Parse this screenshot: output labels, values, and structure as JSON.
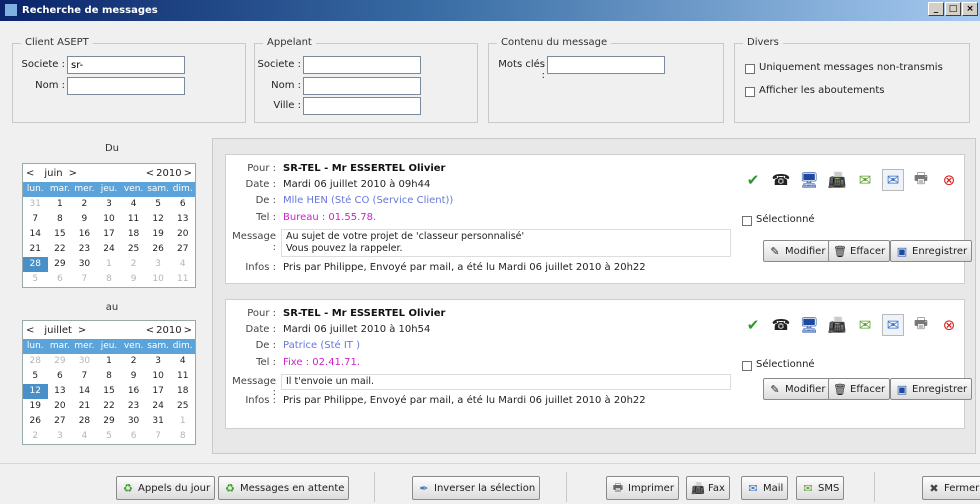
{
  "window": {
    "title": "Recherche de messages",
    "btn_min": "_",
    "btn_max": "□",
    "btn_close": "×"
  },
  "client": {
    "legend": "Client ASEPT",
    "societe_label": "Societe :",
    "societe_value": "sr-",
    "nom_label": "Nom :",
    "nom_value": ""
  },
  "appelant": {
    "legend": "Appelant",
    "societe_label": "Societe :",
    "nom_label": "Nom :",
    "ville_label": "Ville :"
  },
  "contenu": {
    "legend": "Contenu du message",
    "mots_label": "Mots clés :"
  },
  "divers": {
    "legend": "Divers",
    "opt1": "Uniquement messages non-transmis",
    "opt2": "Afficher les aboutements"
  },
  "cal_du": {
    "title": "Du",
    "prev": "<",
    "month": "juin",
    "next": ">",
    "yprev": "<",
    "year": "2010",
    "ynext": ">",
    "dow": [
      "lun.",
      "mar.",
      "mer.",
      "jeu.",
      "ven.",
      "sam.",
      "dim."
    ],
    "days": [
      [
        "31",
        "o"
      ],
      [
        "1",
        ""
      ],
      [
        "2",
        ""
      ],
      [
        "3",
        ""
      ],
      [
        "4",
        ""
      ],
      [
        "5",
        ""
      ],
      [
        "6",
        ""
      ],
      [
        "7",
        ""
      ],
      [
        "8",
        ""
      ],
      [
        "9",
        ""
      ],
      [
        "10",
        ""
      ],
      [
        "11",
        ""
      ],
      [
        "12",
        ""
      ],
      [
        "13",
        ""
      ],
      [
        "14",
        ""
      ],
      [
        "15",
        ""
      ],
      [
        "16",
        ""
      ],
      [
        "17",
        ""
      ],
      [
        "18",
        ""
      ],
      [
        "19",
        ""
      ],
      [
        "20",
        ""
      ],
      [
        "21",
        ""
      ],
      [
        "22",
        ""
      ],
      [
        "23",
        ""
      ],
      [
        "24",
        ""
      ],
      [
        "25",
        ""
      ],
      [
        "26",
        ""
      ],
      [
        "27",
        ""
      ],
      [
        "28",
        "s"
      ],
      [
        "29",
        ""
      ],
      [
        "30",
        ""
      ],
      [
        "1",
        "o"
      ],
      [
        "2",
        "o"
      ],
      [
        "3",
        "o"
      ],
      [
        "4",
        "o"
      ],
      [
        "5",
        "o"
      ],
      [
        "6",
        "o"
      ],
      [
        "7",
        "o"
      ],
      [
        "8",
        "o"
      ],
      [
        "9",
        "o"
      ],
      [
        "10",
        "o"
      ],
      [
        "11",
        "o"
      ]
    ]
  },
  "cal_au": {
    "title": "au",
    "prev": "<",
    "month": "juillet",
    "next": ">",
    "yprev": "<",
    "year": "2010",
    "ynext": ">",
    "dow": [
      "lun.",
      "mar.",
      "mer.",
      "jeu.",
      "ven.",
      "sam.",
      "dim."
    ],
    "days": [
      [
        "28",
        "o"
      ],
      [
        "29",
        "o"
      ],
      [
        "30",
        "o"
      ],
      [
        "1",
        ""
      ],
      [
        "2",
        ""
      ],
      [
        "3",
        ""
      ],
      [
        "4",
        ""
      ],
      [
        "5",
        ""
      ],
      [
        "6",
        ""
      ],
      [
        "7",
        ""
      ],
      [
        "8",
        ""
      ],
      [
        "9",
        ""
      ],
      [
        "10",
        ""
      ],
      [
        "11",
        ""
      ],
      [
        "12",
        "s"
      ],
      [
        "13",
        ""
      ],
      [
        "14",
        ""
      ],
      [
        "15",
        ""
      ],
      [
        "16",
        ""
      ],
      [
        "17",
        ""
      ],
      [
        "18",
        ""
      ],
      [
        "19",
        ""
      ],
      [
        "20",
        ""
      ],
      [
        "21",
        ""
      ],
      [
        "22",
        ""
      ],
      [
        "23",
        ""
      ],
      [
        "24",
        ""
      ],
      [
        "25",
        ""
      ],
      [
        "26",
        ""
      ],
      [
        "27",
        ""
      ],
      [
        "28",
        ""
      ],
      [
        "29",
        ""
      ],
      [
        "30",
        ""
      ],
      [
        "31",
        ""
      ],
      [
        "1",
        "o"
      ],
      [
        "2",
        "o"
      ],
      [
        "3",
        "o"
      ],
      [
        "4",
        "o"
      ],
      [
        "5",
        "o"
      ],
      [
        "6",
        "o"
      ],
      [
        "7",
        "o"
      ],
      [
        "8",
        "o"
      ]
    ]
  },
  "labels": {
    "pour": "Pour :",
    "date": "Date :",
    "de": "De :",
    "tel": "Tel :",
    "message": "Message :",
    "infos": "Infos :",
    "selectionne": "Sélectionné",
    "modifier": "Modifier",
    "effacer": "Effacer",
    "enregistrer": "Enregistrer"
  },
  "messages": [
    {
      "pour": "SR-TEL - Mr ESSERTEL Olivier",
      "date": "Mardi 06 juillet 2010 à 09h44",
      "de": "Mlle HEN       (Sté CO        (Service Client))",
      "tel": "Bureau : 01.55.78.",
      "message_l1": "Au sujet de votre projet de 'classeur personnalisé'",
      "message_l2": "Vous pouvez la rappeler.",
      "infos": "Pris par Philippe, Envoyé par mail, a été lu Mardi 06 juillet 2010 à 20h22"
    },
    {
      "pour": "SR-TEL - Mr ESSERTEL Olivier",
      "date": "Mardi 06 juillet 2010 à 10h54",
      "de": "Patrice (Sté IT        )",
      "tel": "Fixe : 02.41.71.",
      "message_l1": "Il t'envoie un mail.",
      "message_l2": "",
      "infos": "Pris par Philippe, Envoyé par mail, a été lu Mardi 06 juillet 2010 à 20h22"
    }
  ],
  "toolbar": {
    "appels": "Appels du jour",
    "attente": "Messages en attente",
    "inverser": "Inverser la sélection",
    "imprimer": "Imprimer",
    "fax": "Fax",
    "mail": "Mail",
    "sms": "SMS",
    "fermer": "Fermer"
  }
}
